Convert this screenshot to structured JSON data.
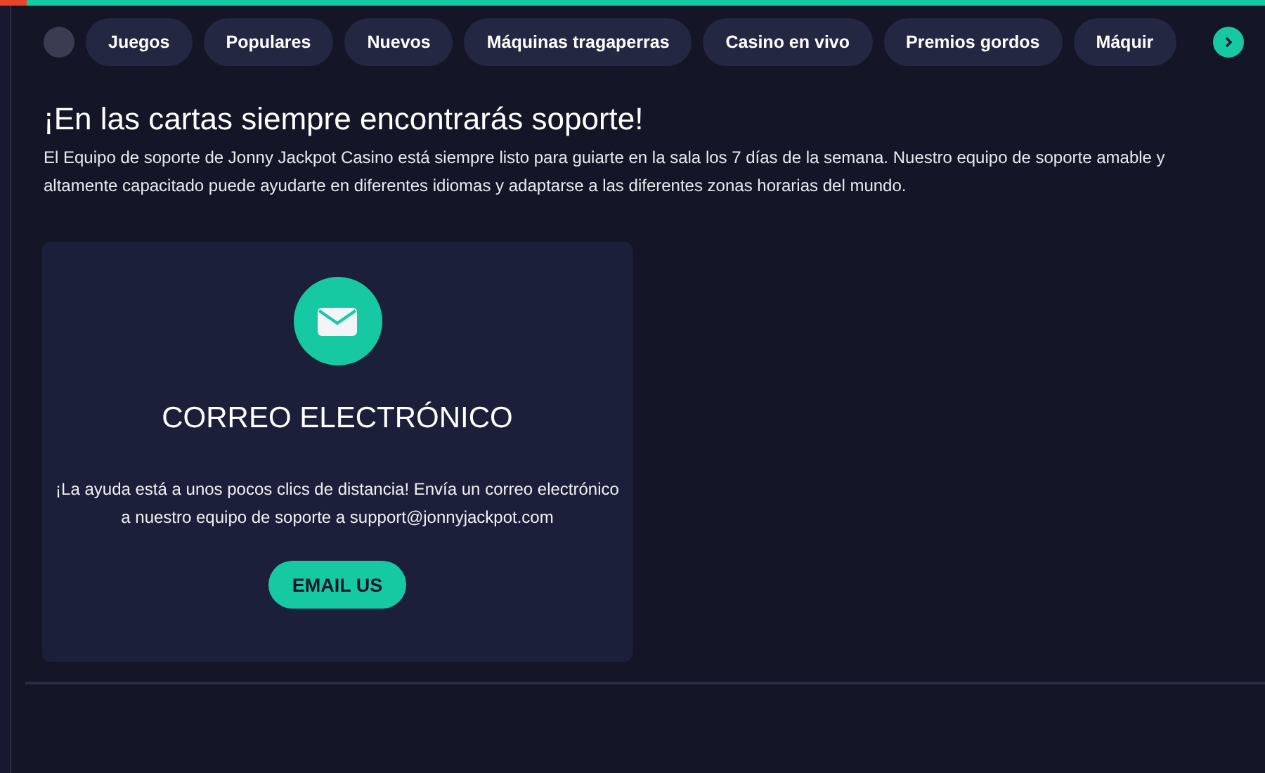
{
  "nav": {
    "items": [
      {
        "label": "Juegos"
      },
      {
        "label": "Populares"
      },
      {
        "label": "Nuevos"
      },
      {
        "label": "Máquinas tragaperras"
      },
      {
        "label": "Casino en vivo"
      },
      {
        "label": "Premios gordos"
      },
      {
        "label": "Máquir"
      }
    ]
  },
  "heading": "¡En las cartas siempre encontrarás soporte!",
  "intro": "El Equipo de soporte de Jonny Jackpot Casino está siempre listo para guiarte en la sala los 7 días de la semana. Nuestro equipo de soporte amable y altamente capacitado puede ayudarte en diferentes idiomas y adaptarse a las diferentes zonas horarias del mundo.",
  "cards": [
    {
      "kind": "email",
      "title": "CORREO ELECTRÓNICO",
      "text": "¡La ayuda está a unos pocos clics de distancia! Envía un correo electrónico a nuestro equipo de soporte a support@jonnyjackpot.com",
      "button": "EMAIL US"
    }
  ]
}
